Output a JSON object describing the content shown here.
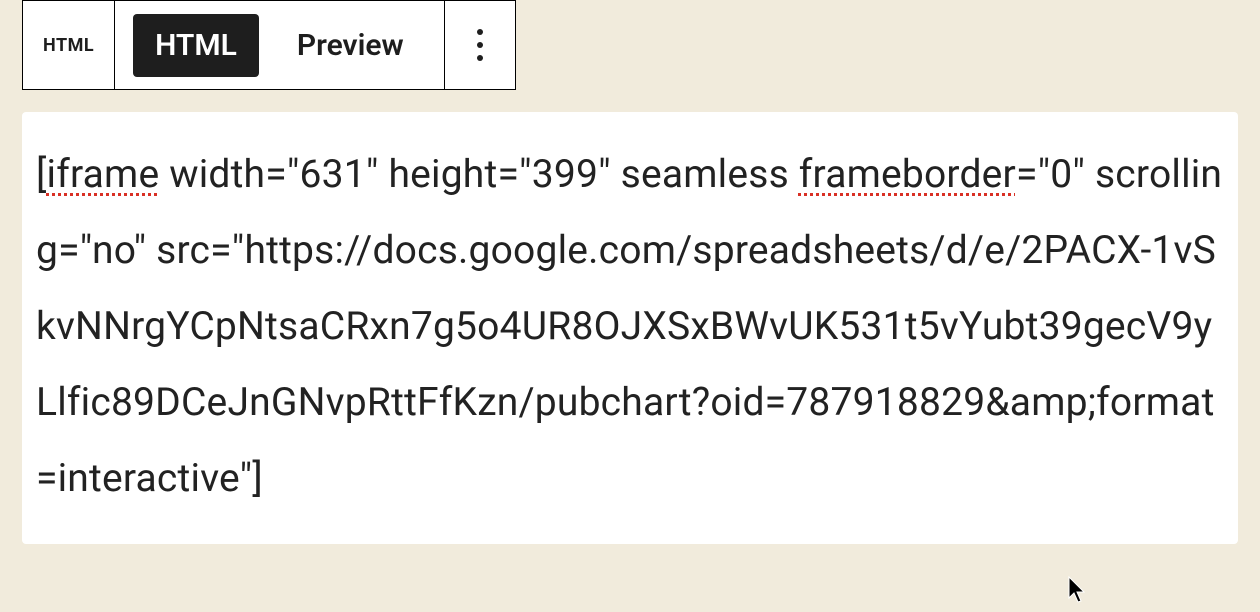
{
  "toolbar": {
    "block_type_label": "HTML",
    "tabs": {
      "html": "HTML",
      "preview": "Preview"
    }
  },
  "code": {
    "prefix": "[",
    "word_iframe": "iframe",
    "seg1": " width=\"631\" height=\"399\" seamless ",
    "word_frameborder": "frameborder",
    "seg2": "=\"0\" scrolling=\"no\" src=\"https://docs.google.com/spreadsheets/d/e/2PACX-1vSkvNNrgYCpNtsaCRxn7g5o4UR8OJXSxBWvUK531t5vYubt39gecV9yLlfic89DCeJnGNvpRttFfKzn/pubchart?oid=787918829&amp;format=interactive\"]"
  }
}
